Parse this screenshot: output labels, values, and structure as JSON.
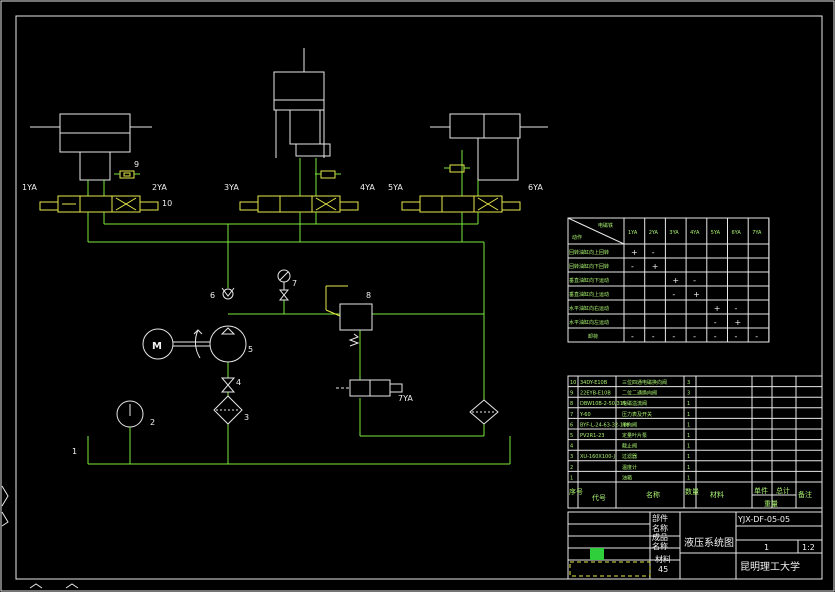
{
  "callouts": {
    "sol_1ya": "1YA",
    "sol_2ya": "2YA",
    "sol_3ya": "3YA",
    "sol_4ya": "4YA",
    "sol_5ya": "5YA",
    "sol_6ya": "6YA",
    "sol_7ya": "7YA",
    "n1": "1",
    "n2": "2",
    "n3": "3",
    "n4": "4",
    "n5": "5",
    "n6": "6",
    "n7": "7",
    "n8": "8",
    "n9": "9",
    "n10": "10",
    "motor": "M"
  },
  "action_table": {
    "header_top": "电磁铁",
    "header_bottom": "动作",
    "columns": [
      "1YA",
      "2YA",
      "3YA",
      "4YA",
      "5YA",
      "6YA",
      "7YA"
    ],
    "rows": [
      {
        "label": "回转油缸向上回转",
        "cells": [
          "+",
          "-",
          "",
          "",
          "",
          "",
          ""
        ]
      },
      {
        "label": "回转油缸向下回转",
        "cells": [
          "-",
          "+",
          "",
          "",
          "",
          "",
          ""
        ]
      },
      {
        "label": "垂直油缸向下运动",
        "cells": [
          "",
          "",
          "+",
          "-",
          "",
          "",
          ""
        ]
      },
      {
        "label": "垂直油缸向上运动",
        "cells": [
          "",
          "",
          "-",
          "+",
          "",
          "",
          ""
        ]
      },
      {
        "label": "水平油缸向右运动",
        "cells": [
          "",
          "",
          "",
          "",
          "+",
          "-",
          ""
        ]
      },
      {
        "label": "水平油缸向左运动",
        "cells": [
          "",
          "",
          "",
          "",
          "-",
          "+",
          ""
        ]
      },
      {
        "label": "卸荷",
        "cells": [
          "-",
          "-",
          "-",
          "-",
          "-",
          "-",
          "-"
        ]
      }
    ]
  },
  "parts_list": {
    "rows": [
      {
        "no": "10",
        "code": "34DY-E10B",
        "name": "三位四通电磁换向阀",
        "qty": "3"
      },
      {
        "no": "9",
        "code": "22EYB-E10B",
        "name": "二位二通换向阀",
        "qty": "3"
      },
      {
        "no": "8",
        "code": "DBW10B-2-50/315",
        "name": "电磁溢流阀",
        "qty": "1"
      },
      {
        "no": "7",
        "code": "Y-60",
        "name": "压力表及开关",
        "qty": "1"
      },
      {
        "no": "6",
        "code": "BYF-L-24-63-32-118",
        "name": "单向阀",
        "qty": "1"
      },
      {
        "no": "5",
        "code": "PV2R1-23",
        "name": "定量叶片泵",
        "qty": "1"
      },
      {
        "no": "4",
        "code": "",
        "name": "截止阀",
        "qty": "1"
      },
      {
        "no": "3",
        "code": "XU-160X100-J",
        "name": "过滤器",
        "qty": "1"
      },
      {
        "no": "2",
        "code": "",
        "name": "温度计",
        "qty": "1"
      },
      {
        "no": "1",
        "code": "",
        "name": "油箱",
        "qty": "1"
      }
    ],
    "header": {
      "no": "序号",
      "code": "代号",
      "name": "名称",
      "qty": "数量",
      "material": "材料",
      "unit_weight": "单件",
      "total_weight": "总计",
      "weight": "重量",
      "remark": "备注"
    }
  },
  "title_block": {
    "drawing_no": "YJX-DF-05-05",
    "title": "液压系统图",
    "qty": "1",
    "scale": "1:2",
    "school": "昆明理工大学",
    "left_labels": [
      "部件",
      "名称",
      "成品",
      "名称",
      "材料",
      "45"
    ]
  }
}
